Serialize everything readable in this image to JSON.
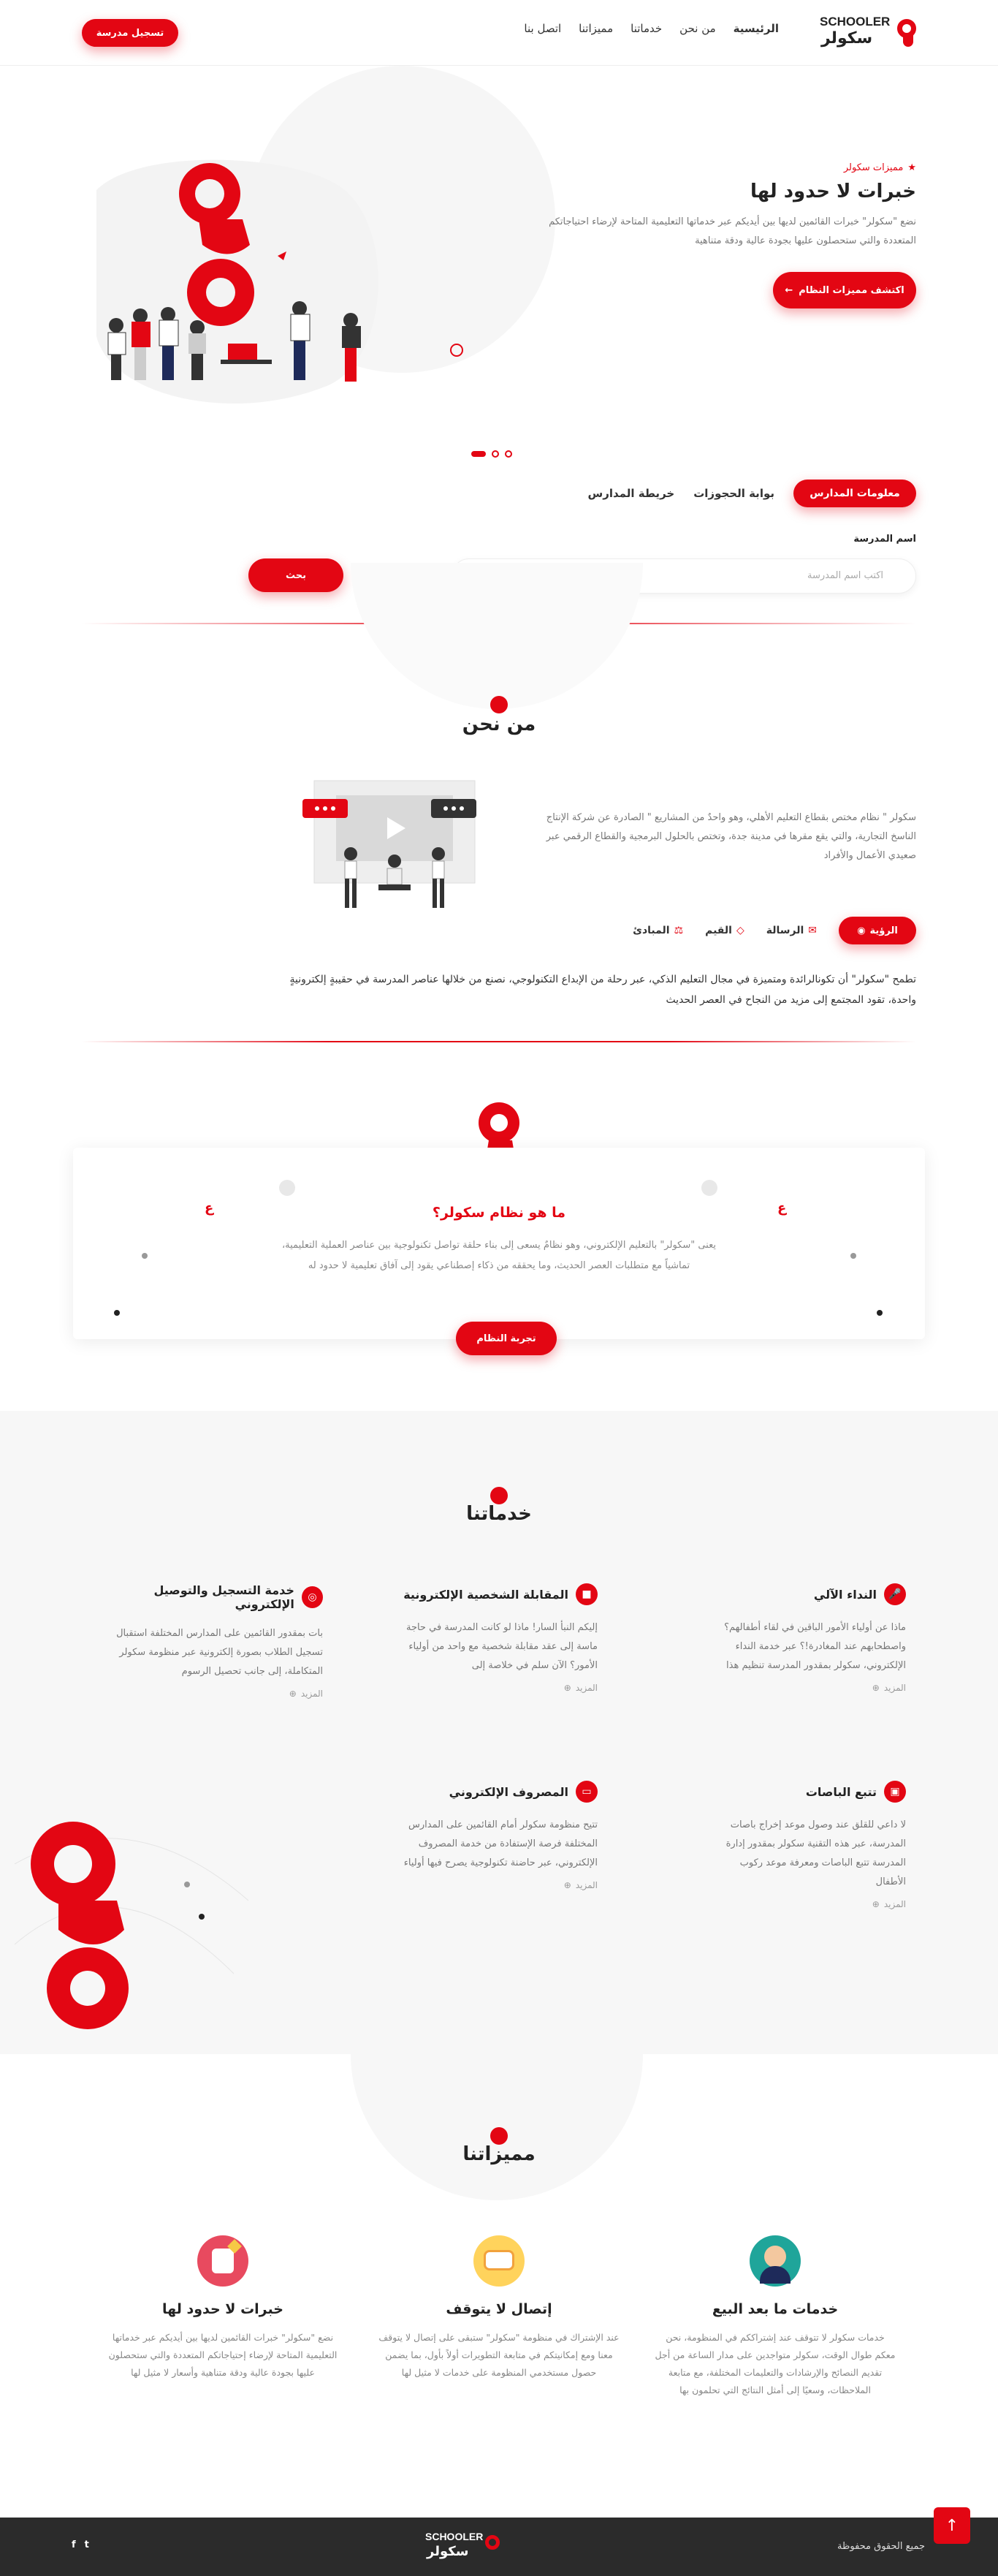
{
  "brand": {
    "latin": "SCHOOLER",
    "arabic": "سكولر",
    "accent": "#e30613"
  },
  "header": {
    "nav": [
      "الرئيسية",
      "من نحن",
      "خدماتنا",
      "مميزاتنا",
      "اتصل بنا"
    ],
    "register_button": "تسجيل مدرسة"
  },
  "hero": {
    "eyebrow": "مميزات سكولر",
    "title": "خبرات لا حدود لها",
    "text": "نضع \"سكولر\" خبرات القائمين لديها بين أيديكم عبر خدماتها التعليمية المتاحة لإرضاء احتياجاتكم المتعددة والتي ستحصلون عليها بجودة عالية ودقة متناهية",
    "cta": "اكتشف مميزات النظام"
  },
  "search": {
    "tabs": [
      "معلومات المدارس",
      "بوابة الحجوزات",
      "خريطة المدارس"
    ],
    "label": "اسم المدرسة",
    "placeholder": "اكتب اسم المدرسة",
    "button": "بحث"
  },
  "about": {
    "title": "من نحن",
    "text": "سكولر \" نظام مختص بقطاع التعليم الأهلي، وهو واحدٌ من المشاريع \" الصادرة عن شركة الإنتاج الناسخ التجارية، والتي يقع مقرها في مدينة جدة، وتختص بالحلول البرمجية والقطاع الرقمي عبر صعيدي الأعمال والأفراد",
    "tabs": [
      "الرؤية",
      "الرسالة",
      "القيم",
      "المبادئ"
    ],
    "vision_text": "تطمح \"سكولر\" أن تكونالرائدة ومتميزة في مجال التعليم الذكي، عبر رحلة من الإبداع التكنولوجي، نصنع من خلالها عناصر المدرسة في حقيبةٍ إلكترونيةٍ واحدة، تقود المجتمع إلى مزيد من النجاح في العصر الحديث"
  },
  "system": {
    "title": "ما هو نظام سكولر؟",
    "text": "يعنى \"سكولر\" بالتعليم الإلكتروني، وهو نظامٌ يسعى إلى بناء حلقة تواصل تكنولوجية بين عناصر العملية التعليمية، تماشياً مع متطلبات العصر الحديث، وما يحققه من ذكاء إصطناعي يقود إلى آفاق تعليمية لا حدود له",
    "button": "تجربة النظام"
  },
  "services": {
    "title": "خدماتنا",
    "more": "المزيد",
    "items": [
      {
        "title": "النداء الآلي",
        "icon": "microphone-icon",
        "text": "ماذا عن أولياء الأمور الباقين في لقاء أطفالهم؟ واصطحابهم عند المغادرة!؟ عبر خدمة النداء الإلكتروني، سكولر بمقدور المدرسة تنظيم هذا"
      },
      {
        "title": "المقابلة الشخصية الإلكترونية",
        "icon": "video-icon",
        "text": "إليكم النبأ السار! ماذا لو كانت المدرسة في حاجة ماسة إلى عقد مقابلة شخصية مع واحد من أولياء الأمور؟ الآن سلم في خلاصة إلى"
      },
      {
        "title": "خدمة التسجيل والتوصيل الإلكتروني",
        "icon": "target-icon",
        "text": "بات بمقدور القائمين على المدارس المختلفة استقبال تسجيل الطلاب بصورة إلكترونية عبر منظومة سكولر المتكاملة، إلى جانب تحصيل الرسوم"
      },
      {
        "title": "تتبع الباصات",
        "icon": "bus-icon",
        "text": "لا داعي للقلق عند وصول موعد إخراج باصات المدرسة، عبر هذه التقنية سكولر بمقدور إدارة المدرسة تتبع الباصات ومعرفة موعد ركوب الأطفال"
      },
      {
        "title": "المصروف الإلكتروني",
        "icon": "card-icon",
        "text": "تتيح منظومة سكولر أمام القائمين على المدارس المختلفة فرصة الإستفادة من خدمة المصروف الإلكتروني، عبر حاضنة تكنولوجية يصرح فيها أولياء"
      }
    ]
  },
  "features": {
    "title": "مميزاتنا",
    "items": [
      {
        "title": "خدمات ما بعد البيع",
        "icon": "support-agent-icon",
        "text": "خدمات سكولر لا تتوقف عند إشتراككم في المنظومة، نحن معكم طوال الوقت، سكولر متواجدين على مدار الساعة من أجل تقديم النصائح والإرشادات والتعليمات المختلفة، مع متابعة الملاحظات، وسعيًا إلى أمثل النتائج التي تحلمون بها"
      },
      {
        "title": "إتصال لا يتوقف",
        "icon": "chat-bubble-icon",
        "text": "عند الإشتراك في منظومة \"سكولر\" ستبقى على إتصال لا يتوقف معنا ومع إمكانيتكم في متابعة التطويرات أولاً بأول، بما يضمن حصول مستخدمي المنظومة على خدمات لا مثيل لها"
      },
      {
        "title": "خبرات لا حدود لها",
        "icon": "thumbs-up-icon",
        "text": "نضع \"سكولر\" خبرات القائمين لديها بين أيديكم عبر خدماتها التعليمية المتاحة لإرضاء إحتياجاتكم المتعددة والتي ستحصلون عليها بجودة عالية ودقة متناهية وأسعار لا مثيل لها"
      }
    ]
  },
  "footer": {
    "copyright": "جميع الحقوق محفوظة",
    "social": [
      "f",
      "t"
    ]
  }
}
